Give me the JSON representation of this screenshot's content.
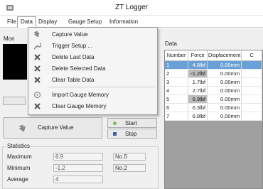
{
  "window": {
    "title": "ZT Logger"
  },
  "menubar": {
    "items": [
      {
        "label": "File"
      },
      {
        "label": "Data"
      },
      {
        "label": "Display"
      },
      {
        "label": "Gauge Setup"
      },
      {
        "label": "Information"
      }
    ]
  },
  "data_menu": {
    "items": [
      {
        "label": "Capture Value",
        "icon": "capture-arrow-icon"
      },
      {
        "label": "Trigger Setup ...",
        "icon": "wrench-icon"
      },
      {
        "label": "Delete Last Data",
        "icon": "delete-x-icon"
      },
      {
        "label": "Delete Selected Data",
        "icon": "delete-x-icon"
      },
      {
        "label": "Clear Table Data",
        "icon": "delete-x-icon"
      },
      {
        "label": "Import Gauge Memory",
        "icon": "import-disk-icon"
      },
      {
        "label": "Clear Gauge Memory",
        "icon": "delete-x-icon"
      }
    ]
  },
  "monitor": {
    "label": "Mon"
  },
  "capture_button": {
    "label": "Capture Value"
  },
  "controls": {
    "start_label": "Start",
    "stop_label": "Stop"
  },
  "statistics": {
    "title": "Statistics",
    "rows": [
      {
        "label": "Maximum",
        "value": "6.9",
        "index": "No.5"
      },
      {
        "label": "Minimum",
        "value": "-1.2",
        "index": "No.2"
      },
      {
        "label": "Average",
        "value": "4",
        "index": ""
      }
    ]
  },
  "data_table": {
    "label": "Data",
    "headers": [
      "Number",
      "Force",
      "Displacement",
      "C"
    ],
    "rows": [
      {
        "number": "1",
        "force": "4.8lbf",
        "displacement": "0.00mm",
        "c": ""
      },
      {
        "number": "2",
        "force": "-1.2lbf",
        "displacement": "0.00mm",
        "c": ""
      },
      {
        "number": "3",
        "force": "1.7lbf",
        "displacement": "0.00mm",
        "c": ""
      },
      {
        "number": "4",
        "force": "2.7lbf",
        "displacement": "0.00mm",
        "c": ""
      },
      {
        "number": "5",
        "force": "6.9lbf",
        "displacement": "0.00mm",
        "c": ""
      },
      {
        "number": "6",
        "force": "6.3lbf",
        "displacement": "0.00mm",
        "c": ""
      },
      {
        "number": "7",
        "force": "6.8lbf",
        "displacement": "0.00mm",
        "c": ""
      }
    ]
  },
  "colors": {
    "selection": "#6aa0d8",
    "highlight_cell": "#bdbdbd",
    "start_green": "#7dbb5a",
    "stop_blue": "#3a5fa8"
  }
}
